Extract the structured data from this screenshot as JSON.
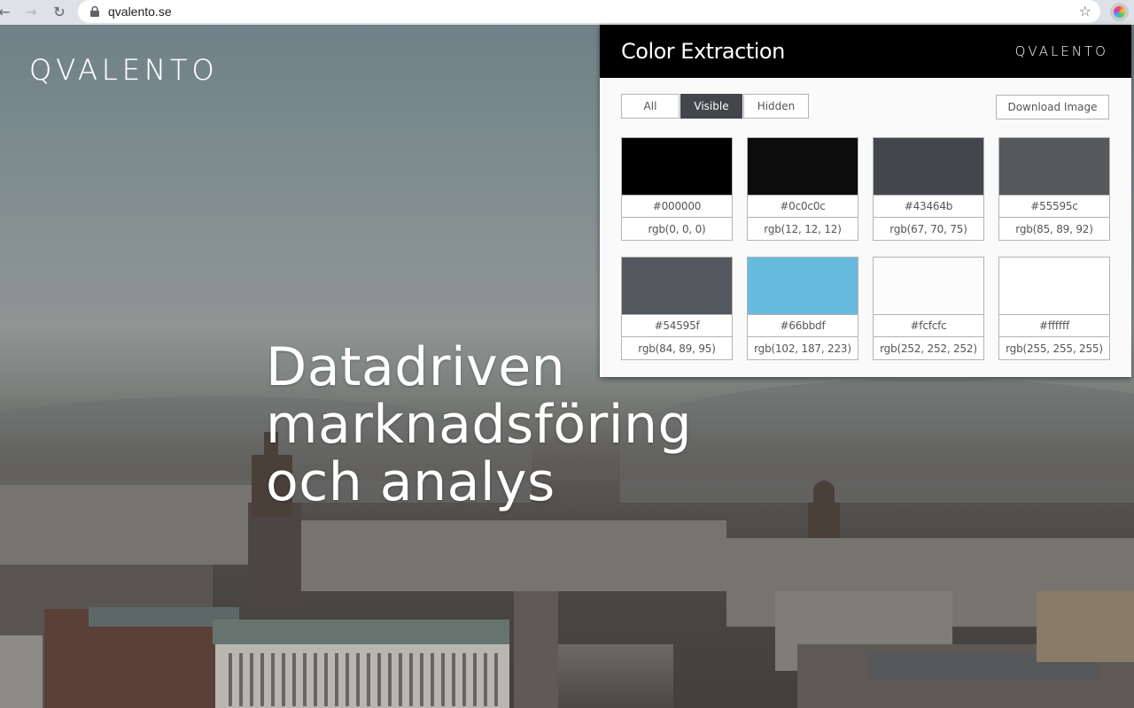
{
  "browser": {
    "url": "qvalento.se",
    "icons": {
      "back": "arrow-left-icon",
      "forward": "arrow-right-icon",
      "reload": "reload-icon",
      "lock": "lock-icon",
      "bookmark": "star-icon",
      "extension": "color-wheel-icon"
    }
  },
  "site": {
    "logo": "QVALENTO",
    "hero_lines": [
      "Datadriven",
      "marknadsföring",
      "och analys"
    ]
  },
  "popup": {
    "title": "Color Extraction",
    "brand": "QVALENTO",
    "filters": [
      {
        "label": "All",
        "active": false
      },
      {
        "label": "Visible",
        "active": true
      },
      {
        "label": "Hidden",
        "active": false
      }
    ],
    "download_label": "Download Image",
    "swatches": [
      {
        "hex": "#000000",
        "rgb": "rgb(0, 0, 0)"
      },
      {
        "hex": "#0c0c0c",
        "rgb": "rgb(12, 12, 12)"
      },
      {
        "hex": "#43464b",
        "rgb": "rgb(67, 70, 75)"
      },
      {
        "hex": "#55595c",
        "rgb": "rgb(85, 89, 92)"
      },
      {
        "hex": "#54595f",
        "rgb": "rgb(84, 89, 95)"
      },
      {
        "hex": "#66bbdf",
        "rgb": "rgb(102, 187, 223)"
      },
      {
        "hex": "#fcfcfc",
        "rgb": "rgb(252, 252, 252)"
      },
      {
        "hex": "#ffffff",
        "rgb": "rgb(255, 255, 255)"
      }
    ]
  }
}
